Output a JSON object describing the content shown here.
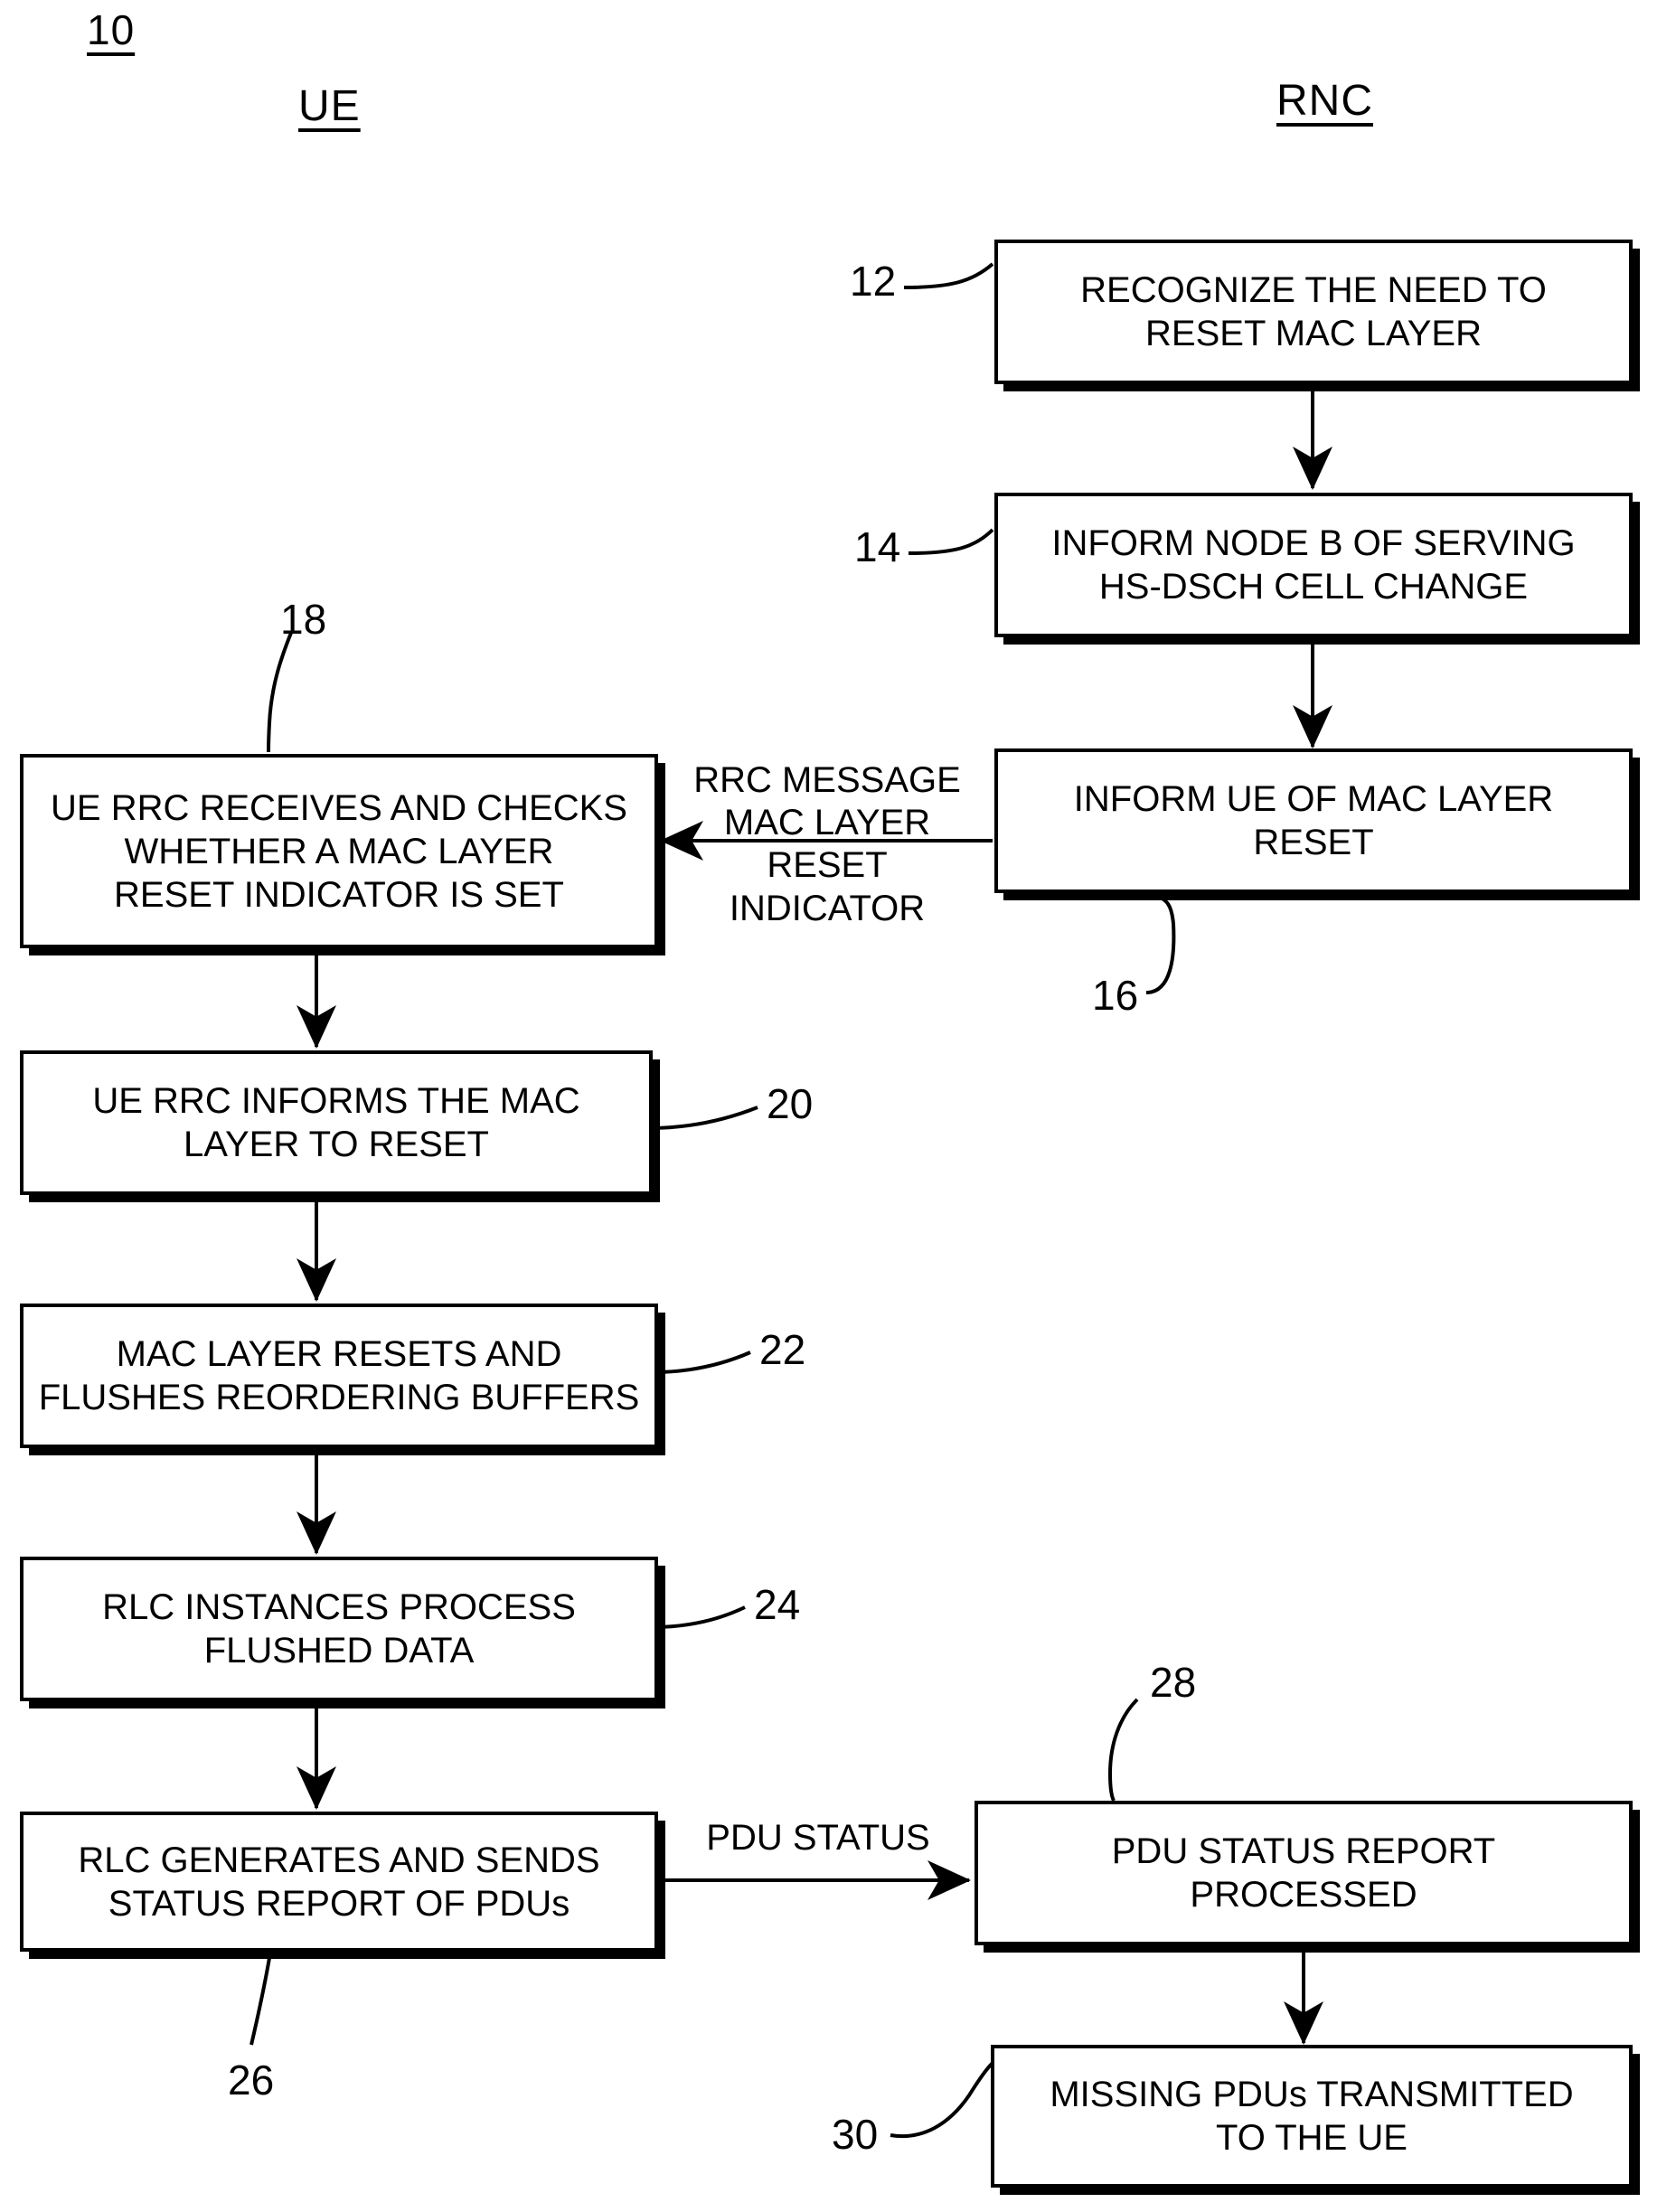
{
  "figure": {
    "number": "10",
    "columns": [
      {
        "id": "ue",
        "label": "UE"
      },
      {
        "id": "rnc",
        "label": "RNC"
      }
    ]
  },
  "boxes": [
    {
      "ref": "12",
      "column": "rnc",
      "text": "RECOGNIZE THE NEED TO\nRESET MAC LAYER"
    },
    {
      "ref": "14",
      "column": "rnc",
      "text": "INFORM NODE B OF SERVING\nHS-DSCH CELL CHANGE"
    },
    {
      "ref": "16",
      "column": "rnc",
      "text": "INFORM UE OF MAC LAYER\nRESET"
    },
    {
      "ref": "18",
      "column": "ue",
      "text": "UE RRC RECEIVES AND CHECKS\nWHETHER A MAC LAYER\nRESET INDICATOR IS SET"
    },
    {
      "ref": "20",
      "column": "ue",
      "text": "UE RRC INFORMS THE MAC\nLAYER TO RESET"
    },
    {
      "ref": "22",
      "column": "ue",
      "text": "MAC LAYER RESETS AND\nFLUSHES REORDERING BUFFERS"
    },
    {
      "ref": "24",
      "column": "ue",
      "text": "RLC INSTANCES PROCESS\nFLUSHED DATA"
    },
    {
      "ref": "26",
      "column": "ue",
      "text": "RLC GENERATES AND SENDS\nSTATUS REPORT OF PDUs"
    },
    {
      "ref": "28",
      "column": "rnc",
      "text": "PDU STATUS REPORT\nPROCESSED"
    },
    {
      "ref": "30",
      "column": "rnc",
      "text": "MISSING PDUs TRANSMITTED\nTO THE UE"
    }
  ],
  "refs": {
    "n12": "12",
    "n14": "14",
    "n16": "16",
    "n18": "18",
    "n20": "20",
    "n22": "22",
    "n24": "24",
    "n26": "26",
    "n28": "28",
    "n30": "30"
  },
  "edge_labels": {
    "rrc_message": "RRC MESSAGE\nMAC LAYER\nRESET INDICATOR",
    "pdu_status": "PDU STATUS"
  },
  "colors": {
    "stroke": "#000000",
    "background": "#ffffff"
  }
}
